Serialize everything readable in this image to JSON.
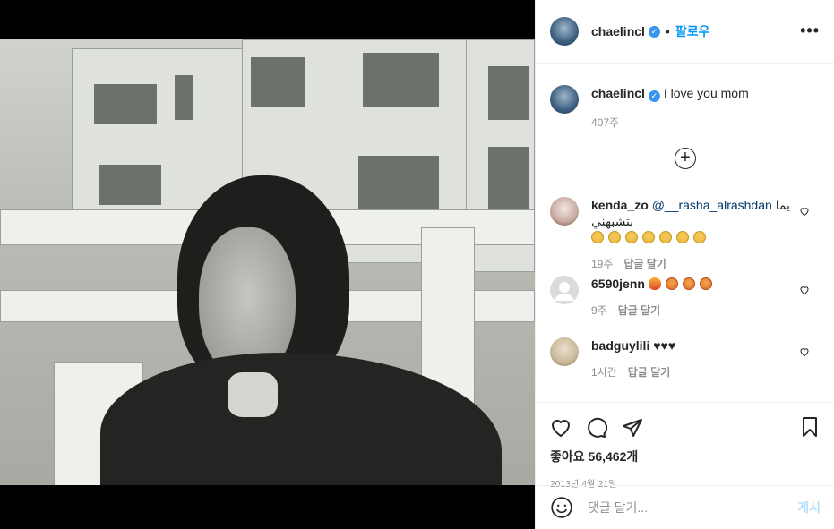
{
  "header": {
    "username": "chaelincl",
    "separator": "•",
    "follow_label": "팔로우",
    "more_label": "•••"
  },
  "caption": {
    "username": "chaelincl",
    "text": "I love you mom",
    "time": "407주"
  },
  "load_more_label": "+",
  "comments": [
    {
      "username": "kenda_zo",
      "mention": "@__rasha_alrashdan",
      "text": "يما بتشبهني",
      "time": "19주",
      "reply_label": "답글 달기",
      "avatar_color": "#d8c8c2"
    },
    {
      "username": "6590jenn",
      "text": "",
      "time": "9주",
      "reply_label": "답글 달기",
      "avatar_color": "#dbdbdb"
    },
    {
      "username": "badguylili",
      "text": "♥♥♥",
      "time": "1시간",
      "reply_label": "답글 달기",
      "avatar_color": "#c9b99a"
    }
  ],
  "actions": {
    "likes_text": "좋아요 56,462개",
    "date": "2013년 4월 21일"
  },
  "comment_box": {
    "placeholder": "댓글 달기...",
    "post_label": "게시"
  },
  "colors": {
    "accent": "#0095f6",
    "verified": "#3897f0",
    "muted": "#8e8e8e",
    "post_disabled": "#b2dffc"
  }
}
